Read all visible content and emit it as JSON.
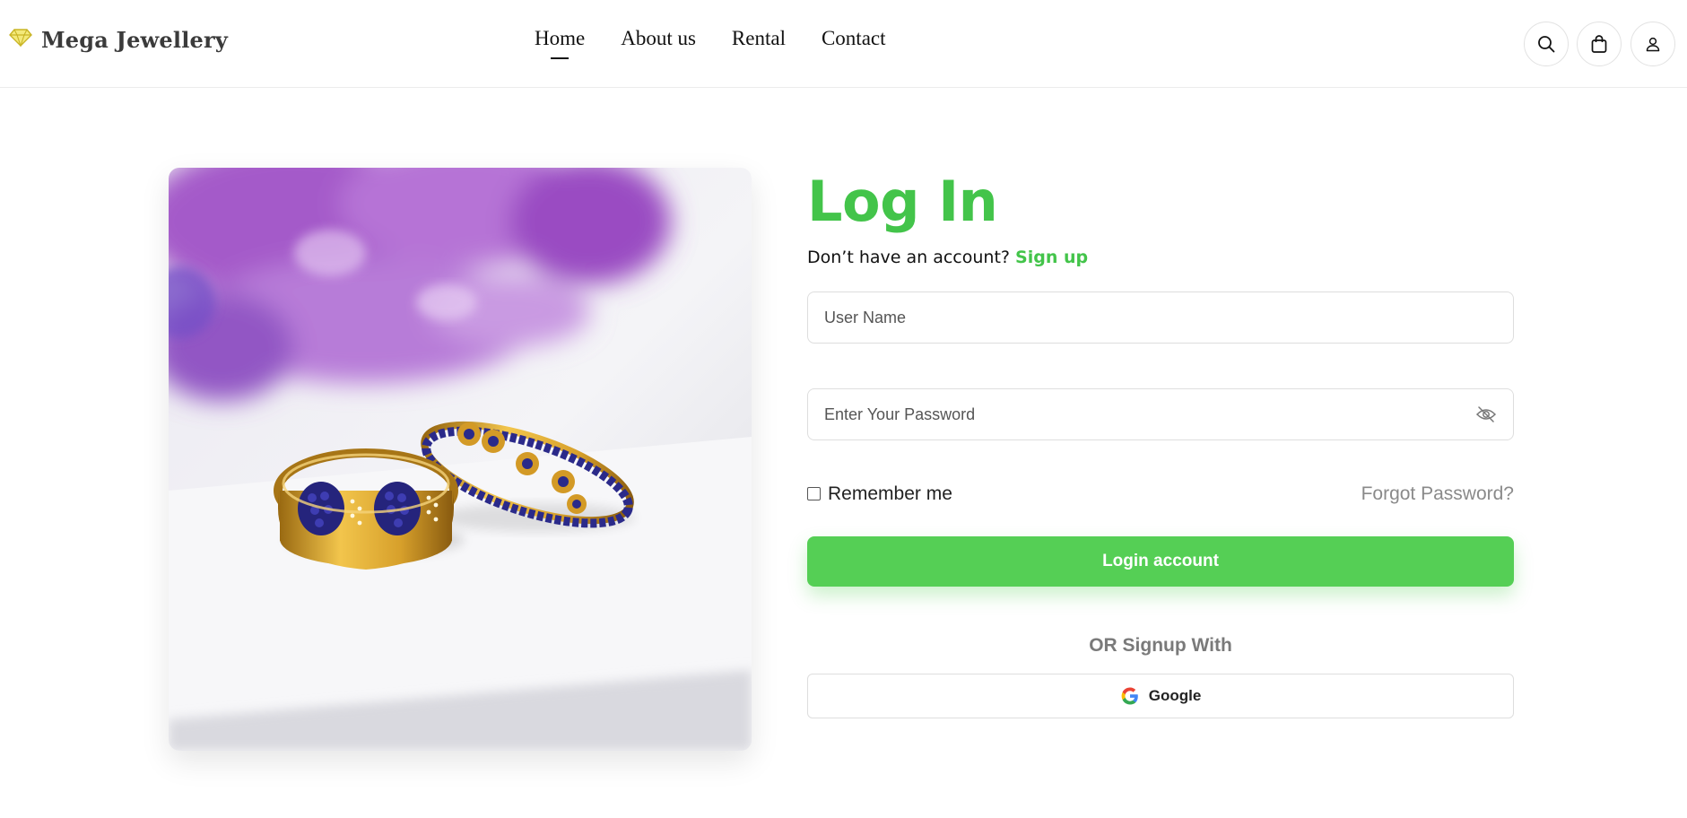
{
  "brand": {
    "name": "Mega Jewellery",
    "icon": "diamond-icon",
    "icon_color": "#e8d84a"
  },
  "nav": {
    "items": [
      {
        "label": "Home",
        "active": true
      },
      {
        "label": "About us",
        "active": false
      },
      {
        "label": "Rental",
        "active": false
      },
      {
        "label": "Contact",
        "active": false
      }
    ]
  },
  "header_icons": [
    "search-icon",
    "shopping-bag-icon",
    "user-icon"
  ],
  "login": {
    "title": "Log In",
    "subtitle_text": "Don’t have an account?",
    "signup_link": "Sign up",
    "username_placeholder": "User Name",
    "password_placeholder": "Enter Your Password",
    "remember_label": "Remember me",
    "remember_checked": false,
    "forgot_label": "Forgot Password?",
    "submit_label": "Login account",
    "or_text": "OR Signup With",
    "google_label": "Google"
  },
  "colors": {
    "accent": "#43c44a",
    "button": "#55cf55",
    "muted": "#8a8a8a"
  }
}
